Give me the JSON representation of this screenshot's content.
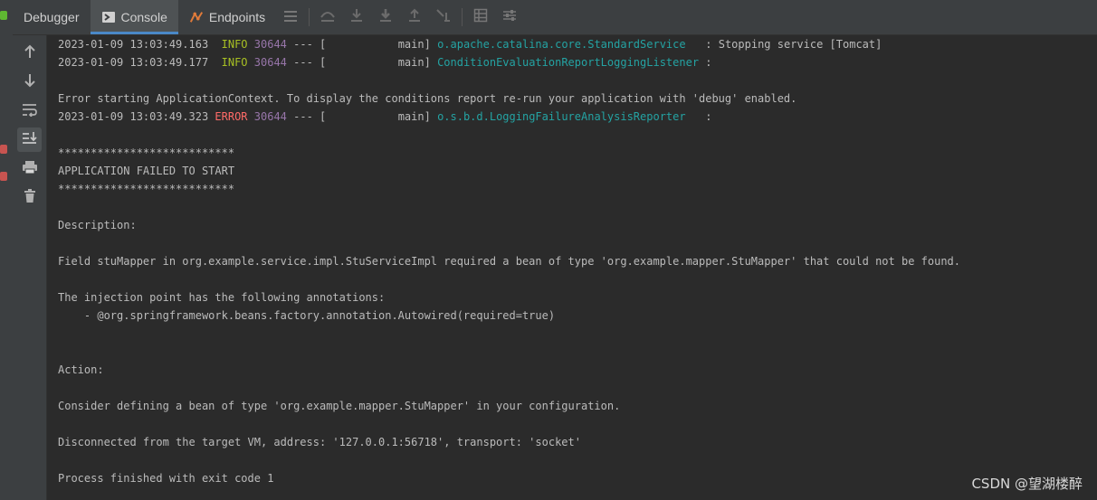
{
  "tabs": [
    {
      "label": "Debugger",
      "active": false
    },
    {
      "label": "Console",
      "active": true
    },
    {
      "label": "Endpoints",
      "active": false
    }
  ],
  "toolbar_icons": [
    "menu-icon",
    "step-over-icon",
    "step-into-icon",
    "force-step-into-icon",
    "step-out-icon",
    "run-to-cursor-icon",
    "frames-grid-icon",
    "settings-icon"
  ],
  "vertical_tools": [
    "up-arrow-icon",
    "down-arrow-icon",
    "soft-wrap-icon",
    "scroll-to-end-icon",
    "print-icon",
    "trash-icon"
  ],
  "log": {
    "l1": {
      "ts": "2023-01-09 13:03:49.163",
      "level": "INFO",
      "pid": "30644",
      "mid": " --- [           main] ",
      "logger": "o.apache.catalina.core.StandardService",
      "msg": "   : Stopping service [Tomcat]"
    },
    "l2": {
      "ts": "2023-01-09 13:03:49.177",
      "level": "INFO",
      "pid": "30644",
      "mid": " --- [           main] ",
      "logger": "ConditionEvaluationReportLoggingListener",
      "msg": " :"
    },
    "l3": "Error starting ApplicationContext. To display the conditions report re-run your application with 'debug' enabled.",
    "l4": {
      "ts": "2023-01-09 13:03:49.323",
      "level": "ERROR",
      "pid": "30644",
      "mid": " --- [           main] ",
      "logger": "o.s.b.d.LoggingFailureAnalysisReporter",
      "msg": "   :"
    },
    "stars": "***************************",
    "failed": "APPLICATION FAILED TO START",
    "desc_h": "Description:",
    "desc": "Field stuMapper in org.example.service.impl.StuServiceImpl required a bean of type 'org.example.mapper.StuMapper' that could not be found.",
    "inj": "The injection point has the following annotations:",
    "ann": "    - @org.springframework.beans.factory.annotation.Autowired(required=true)",
    "action_h": "Action:",
    "action": "Consider defining a bean of type 'org.example.mapper.StuMapper' in your configuration.",
    "disc": "Disconnected from the target VM, address: '127.0.0.1:56718', transport: 'socket'",
    "exit": "Process finished with exit code 1"
  },
  "watermark": "CSDN @望湖楼醉",
  "colors": {
    "info": "#a8c023",
    "error": "#ff6b68",
    "pid": "#9876aa",
    "logger": "#24a3a3",
    "accent": "#4a88c7"
  }
}
